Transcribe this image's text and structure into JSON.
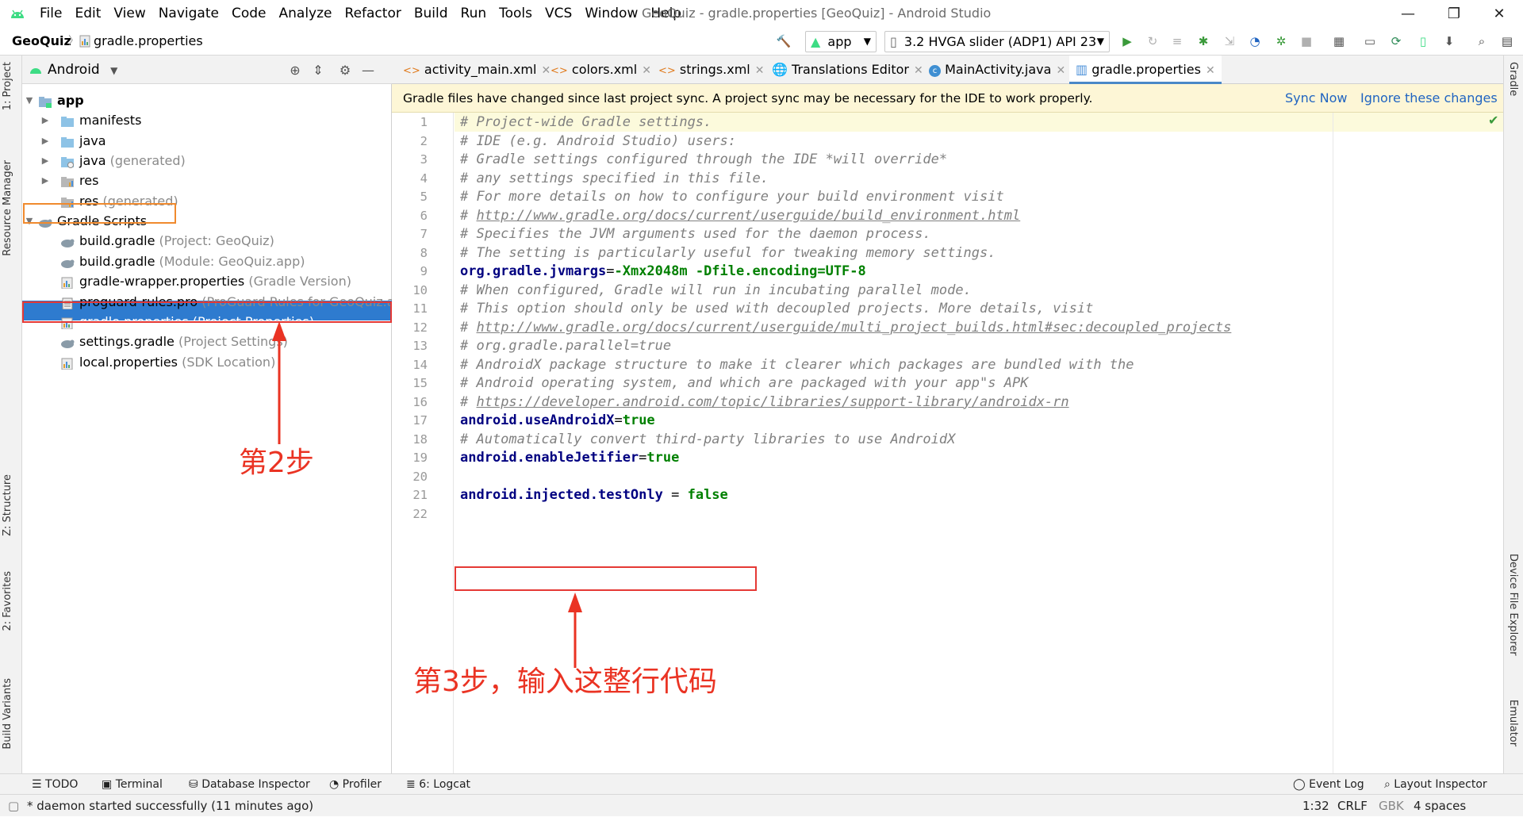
{
  "titlebar": {
    "menu": [
      "File",
      "Edit",
      "View",
      "Navigate",
      "Code",
      "Analyze",
      "Refactor",
      "Build",
      "Run",
      "Tools",
      "VCS",
      "Window",
      "Help"
    ],
    "window_title": "GeoQuiz - gradle.properties [GeoQuiz] - Android Studio",
    "minimize": "—",
    "restore": "❐",
    "close": "✕"
  },
  "navbar": {
    "project": "GeoQuiz",
    "separator": "〉",
    "file": "gradle.properties",
    "run_config": "app",
    "device": "3.2  HVGA slider (ADP1) API 23"
  },
  "left_strip": [
    "1: Project",
    "Resource Manager",
    "Z: Structure",
    "2: Favorites",
    "Build Variants"
  ],
  "right_strip": [
    "Gradle",
    "Device File Explorer",
    "Emulator"
  ],
  "project_panel": {
    "view_mode": "Android",
    "tree": [
      {
        "label": "app",
        "sub": "",
        "indent": 0,
        "arrow": "▼",
        "kind": "module",
        "bold": true
      },
      {
        "label": "manifests",
        "sub": "",
        "indent": 1,
        "arrow": "▶",
        "kind": "folder"
      },
      {
        "label": "java",
        "sub": "",
        "indent": 1,
        "arrow": "▶",
        "kind": "folder"
      },
      {
        "label": "java",
        "sub": "(generated)",
        "indent": 1,
        "arrow": "▶",
        "kind": "folder-gen"
      },
      {
        "label": "res",
        "sub": "",
        "indent": 1,
        "arrow": "▶",
        "kind": "folder-res"
      },
      {
        "label": "res",
        "sub": "(generated)",
        "indent": 1,
        "arrow": "",
        "kind": "folder-res"
      },
      {
        "label": "Gradle Scripts",
        "sub": "",
        "indent": 0,
        "arrow": "▼",
        "kind": "gradle"
      },
      {
        "label": "build.gradle",
        "sub": "(Project: GeoQuiz)",
        "indent": 1,
        "arrow": "",
        "kind": "gradle"
      },
      {
        "label": "build.gradle",
        "sub": "(Module: GeoQuiz.app)",
        "indent": 1,
        "arrow": "",
        "kind": "gradle"
      },
      {
        "label": "gradle-wrapper.properties",
        "sub": "(Gradle Version)",
        "indent": 1,
        "arrow": "",
        "kind": "props"
      },
      {
        "label": "proguard-rules.pro",
        "sub": "(ProGuard Rules for GeoQuiz.app)",
        "indent": 1,
        "arrow": "",
        "kind": "file"
      },
      {
        "label": "gradle.properties",
        "sub": "(Project Properties)",
        "indent": 1,
        "arrow": "",
        "kind": "props",
        "selected": true
      },
      {
        "label": "settings.gradle",
        "sub": "(Project Settings)",
        "indent": 1,
        "arrow": "",
        "kind": "gradle"
      },
      {
        "label": "local.properties",
        "sub": "(SDK Location)",
        "indent": 1,
        "arrow": "",
        "kind": "props"
      }
    ]
  },
  "editor": {
    "tabs": [
      "activity_main.xml",
      "colors.xml",
      "strings.xml",
      "Translations Editor",
      "MainActivity.java",
      "gradle.properties"
    ],
    "banner": {
      "message": "Gradle files have changed since last project sync. A project sync may be necessary for the IDE to work properly.",
      "sync_now": "Sync Now",
      "ignore": "Ignore these changes"
    },
    "lines": [
      {
        "n": "1",
        "type": "comment",
        "text": "# Project-wide Gradle settings."
      },
      {
        "n": "2",
        "type": "comment",
        "text": "# IDE (e.g. Android Studio) users:"
      },
      {
        "n": "3",
        "type": "comment",
        "text": "# Gradle settings configured through the IDE *will override*"
      },
      {
        "n": "4",
        "type": "comment",
        "text": "# any settings specified in this file."
      },
      {
        "n": "5",
        "type": "comment",
        "text": "# For more details on how to configure your build environment visit"
      },
      {
        "n": "6",
        "type": "link",
        "text": "# ",
        "link": "http://www.gradle.org/docs/current/userguide/build_environment.html"
      },
      {
        "n": "7",
        "type": "comment",
        "text": "# Specifies the JVM arguments used for the daemon process."
      },
      {
        "n": "8",
        "type": "comment",
        "text": "# The setting is particularly useful for tweaking memory settings."
      },
      {
        "n": "9",
        "type": "prop",
        "key": "org.gradle.jvmargs",
        "eq": "=",
        "val": "-Xmx2048m -Dfile.encoding=UTF-8"
      },
      {
        "n": "10",
        "type": "comment",
        "text": "# When configured, Gradle will run in incubating parallel mode."
      },
      {
        "n": "11",
        "type": "comment",
        "text": "# This option should only be used with decoupled projects. More details, visit"
      },
      {
        "n": "12",
        "type": "link",
        "text": "# ",
        "link": "http://www.gradle.org/docs/current/userguide/multi_project_builds.html#sec:decoupled_projects"
      },
      {
        "n": "13",
        "type": "comment",
        "text": "# org.gradle.parallel=true"
      },
      {
        "n": "14",
        "type": "comment",
        "text": "# AndroidX package structure to make it clearer which packages are bundled with the"
      },
      {
        "n": "15",
        "type": "comment",
        "text": "# Android operating system, and which are packaged with your app\"s APK"
      },
      {
        "n": "16",
        "type": "link",
        "text": "# ",
        "link": "https://developer.android.com/topic/libraries/support-library/androidx-rn"
      },
      {
        "n": "17",
        "type": "prop",
        "key": "android.useAndroidX",
        "eq": "=",
        "val": "true"
      },
      {
        "n": "18",
        "type": "comment",
        "text": "# Automatically convert third-party libraries to use AndroidX"
      },
      {
        "n": "19",
        "type": "prop",
        "key": "android.enableJetifier",
        "eq": "=",
        "val": "true"
      },
      {
        "n": "20",
        "type": "blank",
        "text": ""
      },
      {
        "n": "21",
        "type": "prop",
        "key": "android.injected.testOnly",
        "eq": " = ",
        "val": "false"
      },
      {
        "n": "22",
        "type": "blank",
        "text": ""
      }
    ]
  },
  "annotations": {
    "step2": "第2步",
    "step3": "第3步，输入这整行代码"
  },
  "bottom_tabs": [
    "TODO",
    "Terminal",
    "Database Inspector",
    "Profiler",
    "6: Logcat",
    "Event Log",
    "Layout Inspector"
  ],
  "status": {
    "message": "* daemon started successfully (11 minutes ago)",
    "position": "1:32",
    "line_sep": "CRLF",
    "encoding": "GBK",
    "indent": "4 spaces"
  },
  "colors": {
    "selection": "#2e7bcf",
    "annotation_red": "#ea3323",
    "annotation_orange": "#f08a2e",
    "banner_bg": "#fdf6d6",
    "link": "#2064c1"
  }
}
